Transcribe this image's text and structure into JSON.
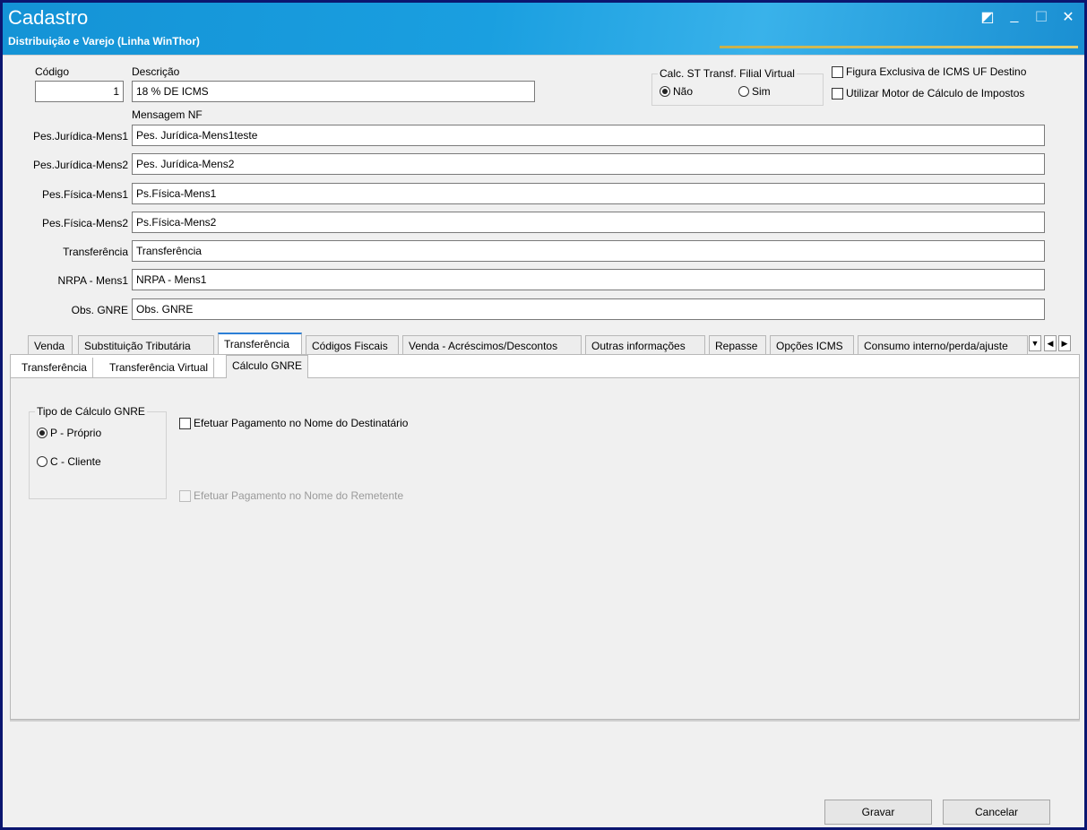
{
  "window": {
    "title": "Cadastro",
    "subtitle": "Distribuição e Varejo (Linha WinThor)",
    "controls": {
      "restore": "◩",
      "minimize": "_",
      "maximize": "☐",
      "close": "✕"
    }
  },
  "header": {
    "codigo_label": "Código",
    "codigo_value": "1",
    "descricao_label": "Descrição",
    "descricao_value": "18 % DE ICMS",
    "calc_st_group": "Calc. ST Transf. Filial Virtual",
    "calc_st_options": {
      "nao": "Não",
      "sim": "Sim"
    },
    "calc_st_selected": "Não",
    "figura_exclusiva_label": "Figura Exclusiva de ICMS UF Destino",
    "figura_exclusiva_checked": false,
    "motor_calculo_label": "Utilizar Motor de Cálculo de Impostos",
    "motor_calculo_checked": false
  },
  "mensagem_nf": {
    "heading": "Mensagem NF",
    "rows": [
      {
        "label": "Pes.Jurídica-Mens1",
        "value": "Pes. Jurídica-Mens1teste"
      },
      {
        "label": "Pes.Jurídica-Mens2",
        "value": "Pes. Jurídica-Mens2"
      },
      {
        "label": "Pes.Física-Mens1",
        "value": "Ps.Física-Mens1"
      },
      {
        "label": "Pes.Física-Mens2",
        "value": "Ps.Física-Mens2"
      },
      {
        "label": "Transferência",
        "value": "Transferência"
      },
      {
        "label": "NRPA - Mens1",
        "value": "NRPA - Mens1"
      },
      {
        "label": "Obs. GNRE",
        "value": "Obs. GNRE"
      }
    ]
  },
  "tabs": [
    "Venda",
    "Substituição Tributária",
    "Transferência",
    "Códigos Fiscais",
    "Venda - Acréscimos/Descontos",
    "Outras informações",
    "Repasse",
    "Opções ICMS",
    "Consumo interno/perda/ajuste"
  ],
  "active_tab": "Transferência",
  "tab_nav": {
    "dropdown": "▼",
    "prev": "◀",
    "next": "▶"
  },
  "subtabs": [
    "Transferência",
    "Transferência Virtual",
    "Cálculo GNRE"
  ],
  "active_subtab": "Cálculo GNRE",
  "calculo_gnre": {
    "tipo_group": "Tipo de Cálculo GNRE",
    "options": {
      "proprio": "P - Próprio",
      "cliente": "C - Cliente"
    },
    "selected": "P - Próprio",
    "pagamento_destinatario_label": "Efetuar Pagamento no Nome do Destinatário",
    "pagamento_destinatario_checked": false,
    "pagamento_remetente_label": "Efetuar Pagamento no Nome do Remetente",
    "pagamento_remetente_checked": false,
    "pagamento_remetente_enabled": false
  },
  "buttons": {
    "gravar": "Gravar",
    "cancelar": "Cancelar"
  }
}
